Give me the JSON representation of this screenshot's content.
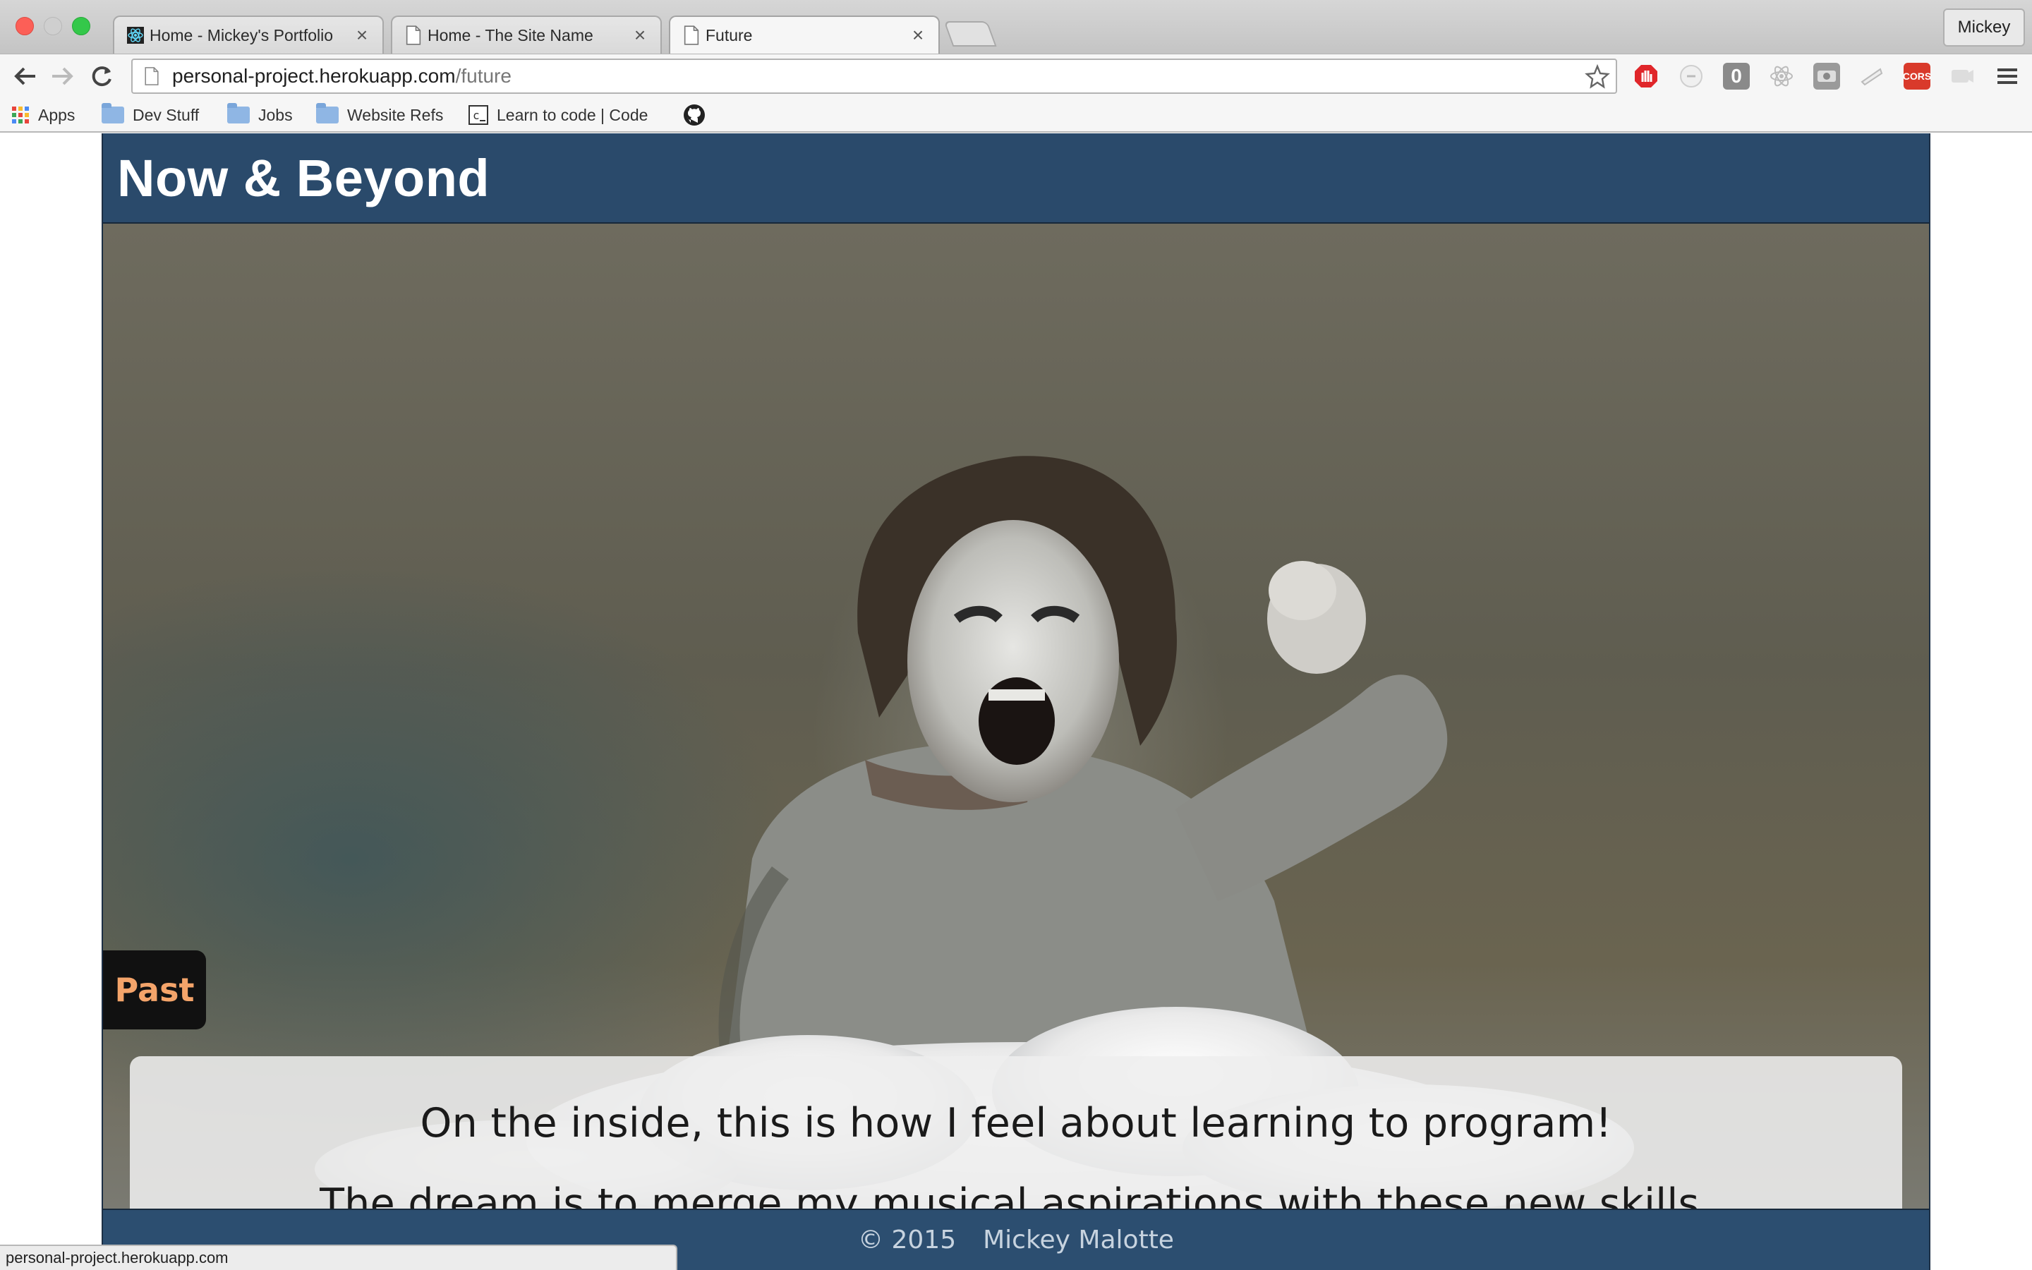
{
  "browser": {
    "tabs": [
      {
        "title": "Home - Mickey's Portfolio",
        "icon": "react-icon",
        "active": false
      },
      {
        "title": "Home - The Site Name",
        "icon": "page-icon",
        "active": false
      },
      {
        "title": "Future",
        "icon": "page-icon",
        "active": true
      }
    ],
    "profile_name": "Mickey",
    "url_host": "personal-project.herokuapp.com",
    "url_path": "/future",
    "bookmarks": [
      {
        "label": "Apps",
        "icon": "apps-grid-icon"
      },
      {
        "label": "Dev Stuff",
        "icon": "folder-icon"
      },
      {
        "label": "Jobs",
        "icon": "folder-icon"
      },
      {
        "label": "Website Refs",
        "icon": "folder-icon"
      },
      {
        "label": "Learn to code | Code",
        "icon": "codecademy-icon"
      },
      {
        "label": "",
        "icon": "github-icon"
      }
    ],
    "extensions": [
      "adblock-icon",
      "extension-icon",
      "counter-icon",
      "react-devtools-icon",
      "extension-icon",
      "extension-icon",
      "cors-icon",
      "extension-icon",
      "menu-icon"
    ],
    "extension_cors_label": "CORS",
    "extension_counter_label": "0",
    "status_url": "personal-project.herokuapp.com"
  },
  "page": {
    "title": "Now & Beyond",
    "past_link": "Past",
    "caption_lines": [
      "On the inside, this is how I feel about learning to program!",
      "The dream is to merge my musical aspirations with these new skills."
    ],
    "footer_year": "© 2015",
    "footer_name": "Mickey Malotte"
  },
  "colors": {
    "header_bg": "#2a4a6b",
    "footer_bg": "#2c4e70",
    "past_text": "#f4a46a"
  }
}
